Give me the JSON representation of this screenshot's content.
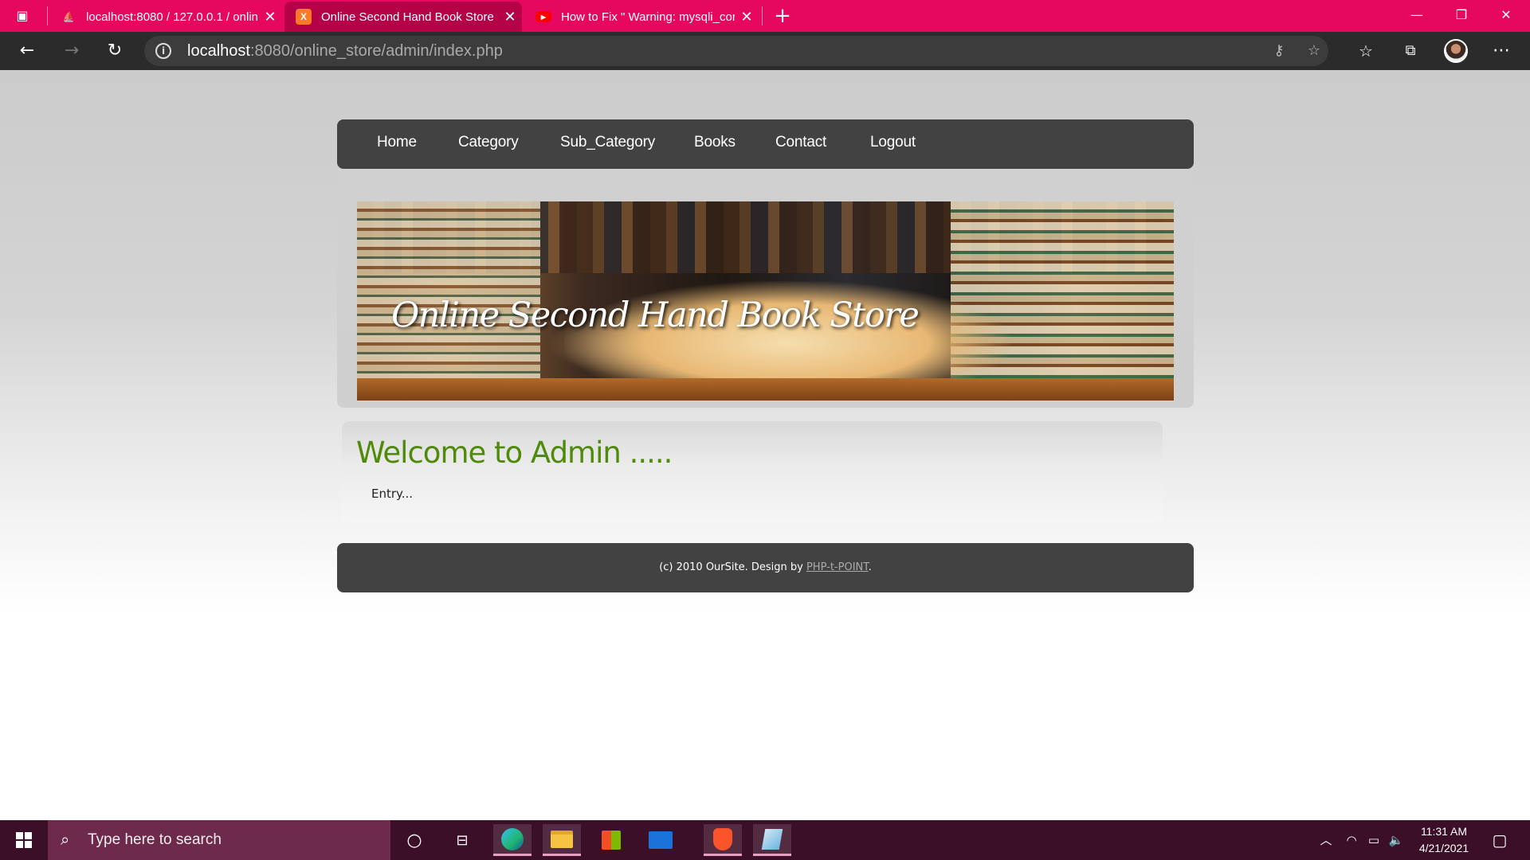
{
  "browser": {
    "tabs": [
      {
        "title": "localhost:8080 / 127.0.0.1 / onlin",
        "favicon": "phpmyadmin-icon"
      },
      {
        "title": "Online Second Hand Book Store",
        "favicon": "xampp-icon",
        "active": true
      },
      {
        "title": "How to Fix \" Warning: mysqli_cor",
        "favicon": "youtube-icon"
      }
    ],
    "url_host": "localhost",
    "url_rest": ":8080/online_store/admin/index.php",
    "accent": "#e6085f"
  },
  "site": {
    "nav": [
      "Home",
      "Category",
      "Sub_Category",
      "Books",
      "Contact",
      "Logout"
    ],
    "banner_title": "Online Second Hand Book Store",
    "welcome": "Welcome to Admin .....",
    "entry": "Entry...",
    "footer_prefix": "(c) 2010 OurSite. Design by ",
    "footer_link": "PHP-t-POINT",
    "footer_suffix": ".",
    "heading_color": "#4f8a0b"
  },
  "taskbar": {
    "search_placeholder": "Type here to search",
    "time": "11:31 AM",
    "date": "4/21/2021"
  }
}
